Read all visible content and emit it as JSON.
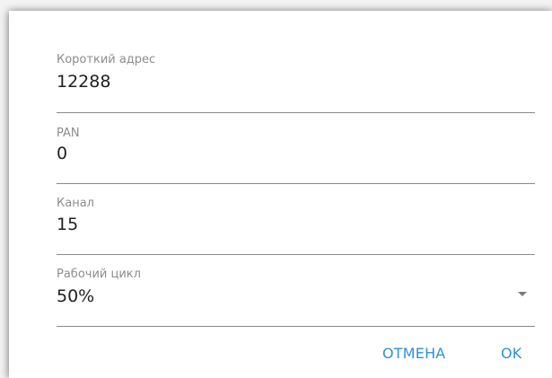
{
  "fields": [
    {
      "label": "Короткий адрес",
      "value": "12288"
    },
    {
      "label": "PAN",
      "value": "0"
    },
    {
      "label": "Канал",
      "value": "15"
    },
    {
      "label": "Рабочий цикл",
      "value": "50%"
    }
  ],
  "actions": {
    "cancel_label": "ОТМЕНА",
    "ok_label": "OK"
  },
  "icons": {
    "dropdown": "chevron-down-icon"
  },
  "colors": {
    "accent": "#2f8fe0",
    "label": "#8d8d8d",
    "value": "#1f1f1f",
    "divider": "#8a8a8a"
  }
}
